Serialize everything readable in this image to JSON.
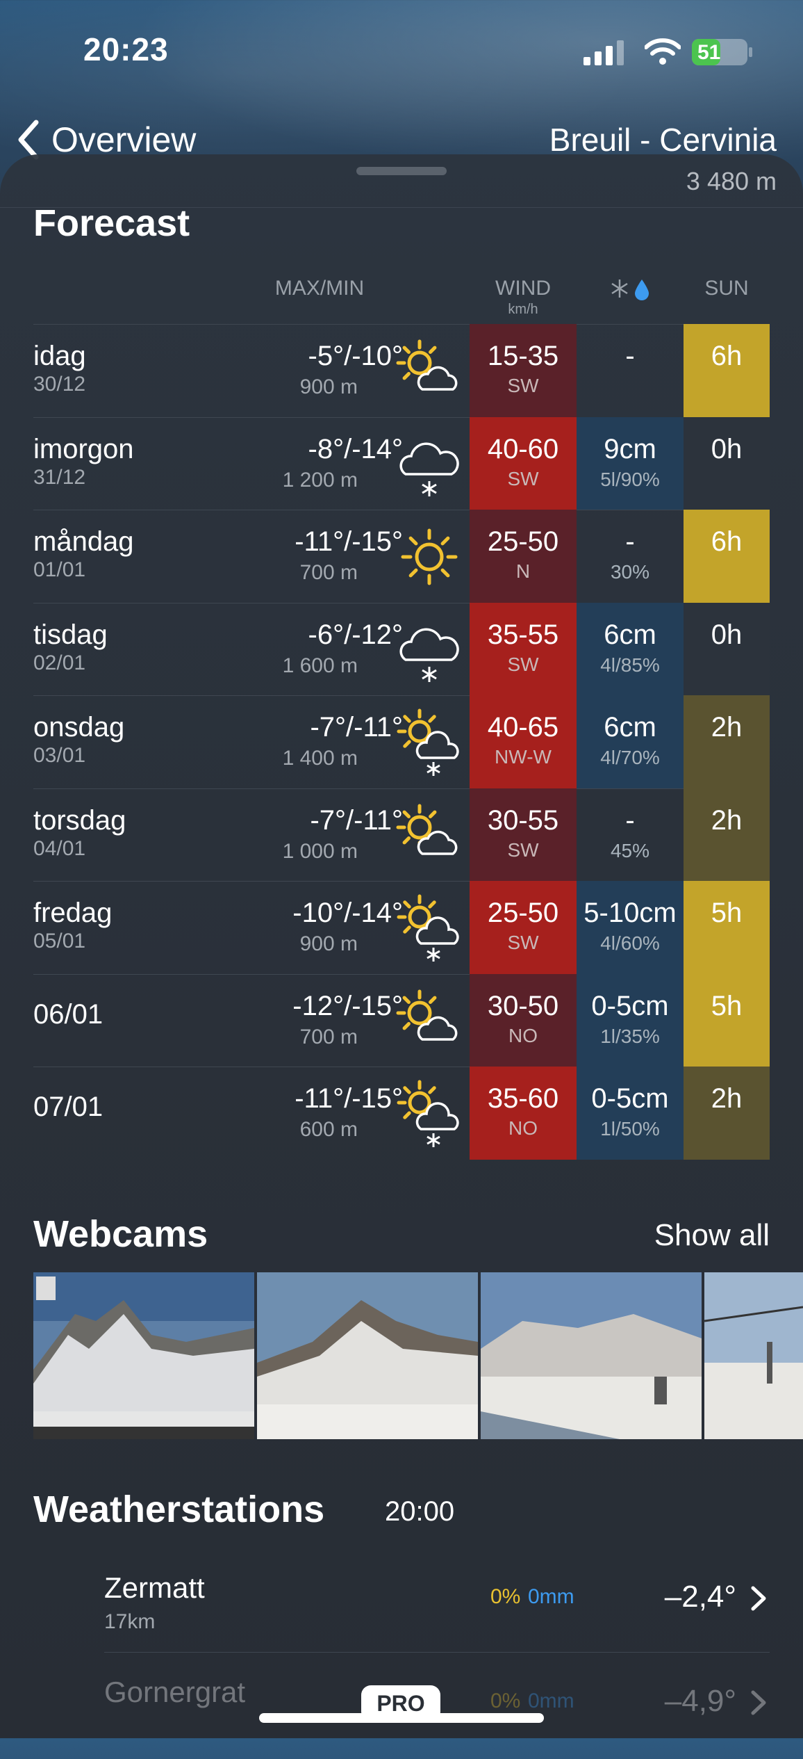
{
  "status_bar": {
    "time": "20:23",
    "battery": "51",
    "battery_level_percent": 51
  },
  "nav": {
    "back_label": "Overview",
    "location": "Breuil - Cervinia",
    "altitude": "3 480 m"
  },
  "forecast": {
    "title": "Forecast",
    "headers": {
      "maxmin": "MAX/MIN",
      "wind": "WIND",
      "wind_unit": "km/h",
      "sun": "SUN"
    },
    "rows": [
      {
        "day": "idag",
        "date": "30/12",
        "temp": "-5°/-10°",
        "level": "900 m",
        "icon": "sun-cloud-icon",
        "wind": "15-35",
        "dir": "SW",
        "snow": "-",
        "snow_detail": "",
        "sun": "6h"
      },
      {
        "day": "imorgon",
        "date": "31/12",
        "temp": "-8°/-14°",
        "level": "1 200 m",
        "icon": "cloud-snow-icon",
        "wind": "40-60",
        "dir": "SW",
        "snow": "9cm",
        "snow_detail": "5l/90%",
        "sun": "0h"
      },
      {
        "day": "måndag",
        "date": "01/01",
        "temp": "-11°/-15°",
        "level": "700 m",
        "icon": "sun-icon",
        "wind": "25-50",
        "dir": "N",
        "snow": "-",
        "snow_detail": "30%",
        "sun": "6h"
      },
      {
        "day": "tisdag",
        "date": "02/01",
        "temp": "-6°/-12°",
        "level": "1 600 m",
        "icon": "cloud-snow-icon",
        "wind": "35-55",
        "dir": "SW",
        "snow": "6cm",
        "snow_detail": "4l/85%",
        "sun": "0h"
      },
      {
        "day": "onsdag",
        "date": "03/01",
        "temp": "-7°/-11°",
        "level": "1 400 m",
        "icon": "sun-cloud-snow-icon",
        "wind": "40-65",
        "dir": "NW-W",
        "snow": "6cm",
        "snow_detail": "4l/70%",
        "sun": "2h"
      },
      {
        "day": "torsdag",
        "date": "04/01",
        "temp": "-7°/-11°",
        "level": "1 000 m",
        "icon": "sun-cloud-icon",
        "wind": "30-55",
        "dir": "SW",
        "snow": "-",
        "snow_detail": "45%",
        "sun": "2h"
      },
      {
        "day": "fredag",
        "date": "05/01",
        "temp": "-10°/-14°",
        "level": "900 m",
        "icon": "sun-cloud-snow-icon",
        "wind": "25-50",
        "dir": "SW",
        "snow": "5-10cm",
        "snow_detail": "4l/60%",
        "sun": "5h"
      },
      {
        "day": "06/01",
        "date": "",
        "temp": "-12°/-15°",
        "level": "700 m",
        "icon": "sun-cloud-icon",
        "wind": "30-50",
        "dir": "NO",
        "snow": "0-5cm",
        "snow_detail": "1l/35%",
        "sun": "5h"
      },
      {
        "day": "07/01",
        "date": "",
        "temp": "-11°/-15°",
        "level": "600 m",
        "icon": "sun-cloud-snow-icon",
        "wind": "35-60",
        "dir": "NO",
        "snow": "0-5cm",
        "snow_detail": "1l/50%",
        "sun": "2h"
      }
    ]
  },
  "webcams": {
    "title": "Webcams",
    "show_all": "Show all"
  },
  "weatherstations": {
    "title": "Weatherstations",
    "time": "20:00",
    "stations": [
      {
        "name": "Zermatt",
        "distance": "17km",
        "precip_pct": "0%",
        "precip_mm": "0mm",
        "temp": "–2,4°"
      },
      {
        "name": "Gornergrat",
        "distance": "",
        "precip_pct": "0%",
        "precip_mm": "0mm",
        "temp": "–4,9°"
      }
    ]
  },
  "pro_badge": "PRO",
  "colors": {
    "wind_strong": "#a6201d",
    "wind_mild": "#5a2129",
    "snow_bg": "#233e58",
    "sun_bright": "#c3a42a",
    "sun_dim": "#5a5330",
    "sun_none": "#2c333c"
  }
}
